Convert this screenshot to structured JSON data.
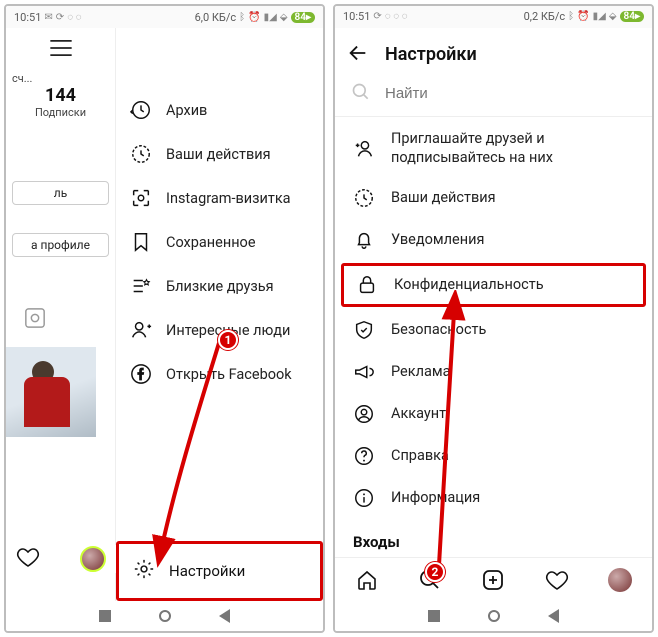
{
  "status": {
    "time": "10:51",
    "left_net": "6,0 КБ/с",
    "right_net": "0,2 КБ/с",
    "battery": "84"
  },
  "left": {
    "stat_number": "144",
    "stat_label": "Подписки",
    "cut_prefix": "сч...",
    "btn1": "ль",
    "btn2": "а профиле",
    "menu": {
      "archive": "Архив",
      "activity": "Ваши действия",
      "nametag": "Instagram-визитка",
      "saved": "Сохраненное",
      "close_friends": "Близкие друзья",
      "discover": "Интересные люди",
      "facebook": "Открыть Facebook"
    },
    "settings": "Настройки"
  },
  "right": {
    "title": "Настройки",
    "search_placeholder": "Найти",
    "items": {
      "invite": "Приглашайте друзей и подписывайтесь на них",
      "activity": "Ваши действия",
      "notifications": "Уведомления",
      "privacy": "Конфиденциальность",
      "security": "Безопасность",
      "ads": "Реклама",
      "account": "Аккаунт",
      "help": "Справка",
      "about": "Информация"
    },
    "logins_head": "Входы"
  },
  "badges": {
    "one": "1",
    "two": "2"
  }
}
